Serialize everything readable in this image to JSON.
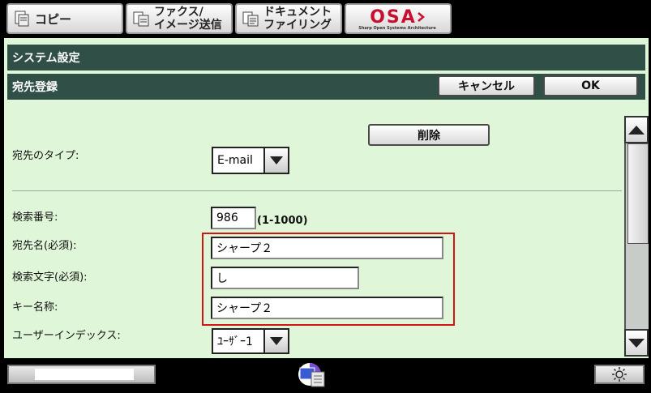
{
  "tabs": [
    {
      "label": "コピー",
      "icon": "copy-icon"
    },
    {
      "line1": "ファクス/",
      "line2": "イメージ送信",
      "icon": "fax-scan-icon"
    },
    {
      "line1": "ドキュメント",
      "line2": "ファイリング",
      "icon": "document-filing-icon"
    }
  ],
  "osa": {
    "text": "OSA",
    "subtitle": "Sharp Open Systems Architecture"
  },
  "header": {
    "system_title": "システム設定",
    "page_title": "宛先登録"
  },
  "buttons": {
    "cancel": "キャンセル",
    "ok": "OK",
    "delete": "削除"
  },
  "form": {
    "dest_type_label": "宛先のタイプ:",
    "dest_type_value": "E-mail",
    "search_no_label": "検索番号:",
    "search_no_value": "986",
    "search_no_range": "(1-1000)",
    "dest_name_label": "宛先名(必須):",
    "dest_name_value": "シャープ２",
    "search_char_label": "検索文字(必須):",
    "search_char_value": "し",
    "key_name_label": "キー名称:",
    "key_name_value": "シャープ２",
    "user_index_label": "ユーザーインデックス:",
    "user_index_value": "ﾕｰｻﾞｰ1"
  },
  "colors": {
    "header_bg": "#2f4f47",
    "panel_bg": "#dff7d8",
    "highlight": "#d31414"
  }
}
